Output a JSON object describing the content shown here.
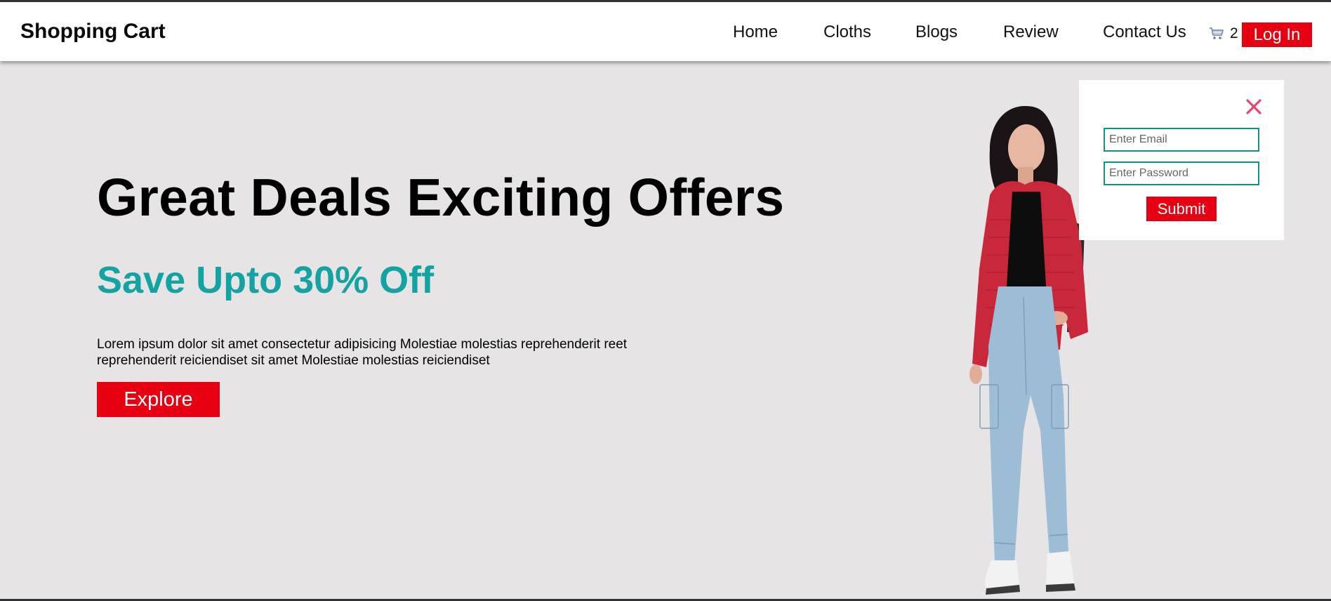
{
  "header": {
    "brand": "Shopping Cart",
    "nav": [
      {
        "label": "Home"
      },
      {
        "label": "Cloths"
      },
      {
        "label": "Blogs"
      },
      {
        "label": "Review"
      },
      {
        "label": "Contact Us"
      }
    ],
    "cart": {
      "icon": "cart-icon",
      "count": "2"
    },
    "login_label": "Log In"
  },
  "hero": {
    "title": "Great Deals Exciting Offers",
    "subtitle": "Save Upto 30% Off",
    "description": "Lorem ipsum dolor sit amet consectetur adipisicing Molestiae molestias reprehenderit reet reprehenderit reiciendiset sit amet Molestiae molestias reiciendiset",
    "explore_label": "Explore"
  },
  "login_form": {
    "close_icon": "close-icon",
    "email_placeholder": "Enter Email",
    "email_value": "",
    "password_placeholder": "Enter Password",
    "password_value": "",
    "submit_label": "Submit"
  },
  "colors": {
    "accent_red": "#e60012",
    "teal": "#14a3a3",
    "close_pink": "#e8456b",
    "hero_background": "#e6e4e5"
  }
}
